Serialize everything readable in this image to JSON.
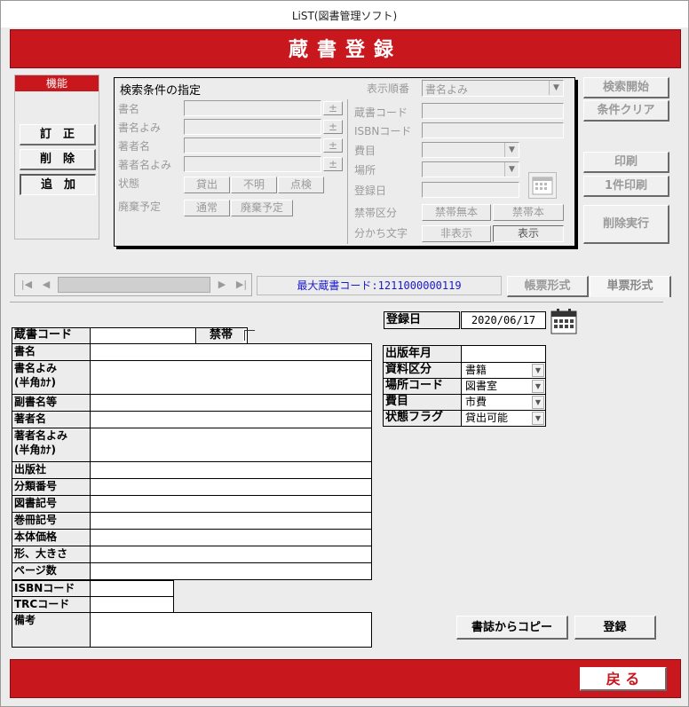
{
  "window": {
    "title": "LiST(図書管理ソフト)"
  },
  "header": {
    "title": "蔵書登録"
  },
  "function_panel": {
    "label": "機能",
    "edit": "訂　正",
    "delete": "削　除",
    "add": "追　加"
  },
  "search": {
    "title": "検索条件の指定",
    "sort_label": "表示順番",
    "sort_value": "書名よみ",
    "fields_left": [
      "書名",
      "書名よみ",
      "著者名",
      "著者名よみ"
    ],
    "plus": "±",
    "status_label": "状態",
    "status_options": [
      "貸出",
      "不明",
      "点検"
    ],
    "disposal_label": "廃棄予定",
    "disposal_options": [
      "通常",
      "廃棄予定"
    ],
    "fields_right": [
      "蔵書コード",
      "ISBNコード",
      "費目",
      "場所",
      "登録日"
    ],
    "restrict_label": "禁帯区分",
    "restrict_options": [
      "禁帯無本",
      "禁帯本"
    ],
    "split_label": "分かち文字",
    "split_options": [
      "非表示",
      "表示"
    ]
  },
  "actions": {
    "search_start": "検索開始",
    "clear": "条件クリア",
    "print": "印刷",
    "print_one": "1件印刷",
    "delete_exec": "削除実行"
  },
  "navigator": {
    "first": "|◀",
    "prev": "◀",
    "next": "▶",
    "last": "▶|",
    "max_code_label": "最大蔵書コード:1211000000119",
    "tab_list": "帳票形式",
    "tab_single": "単票形式"
  },
  "form": {
    "reg_date_label": "登録日",
    "reg_date_value": "2020/06/17",
    "code_label": "蔵書コード",
    "restricted_label": "禁帯",
    "rows": [
      {
        "label": "書名"
      },
      {
        "label": "書名よみ\n(半角ｶﾅ)"
      },
      {
        "label": "副書名等"
      },
      {
        "label": "著者名"
      },
      {
        "label": "著者名よみ\n(半角ｶﾅ)"
      },
      {
        "label": "出版社"
      },
      {
        "label": "分類番号"
      },
      {
        "label": "図書記号"
      },
      {
        "label": "巻冊記号"
      },
      {
        "label": "本体価格"
      },
      {
        "label": "形、大きさ"
      },
      {
        "label": "ページ数"
      },
      {
        "label": "ISBNコード"
      },
      {
        "label": "TRCコード"
      },
      {
        "label": "備考"
      }
    ],
    "pub_date_label": "出版年月",
    "material_label": "資料区分",
    "material_value": "書籍",
    "location_label": "場所コード",
    "location_value": "図書室",
    "expense_label": "費目",
    "expense_value": "市費",
    "status_flag_label": "状態フラグ",
    "status_flag_value": "貸出可能"
  },
  "buttons": {
    "copy_from_catalog": "書誌からコピー",
    "register": "登録",
    "back": "戻 る"
  },
  "colors": {
    "header_red": "#c8181e",
    "link_blue": "#1a1acc"
  }
}
